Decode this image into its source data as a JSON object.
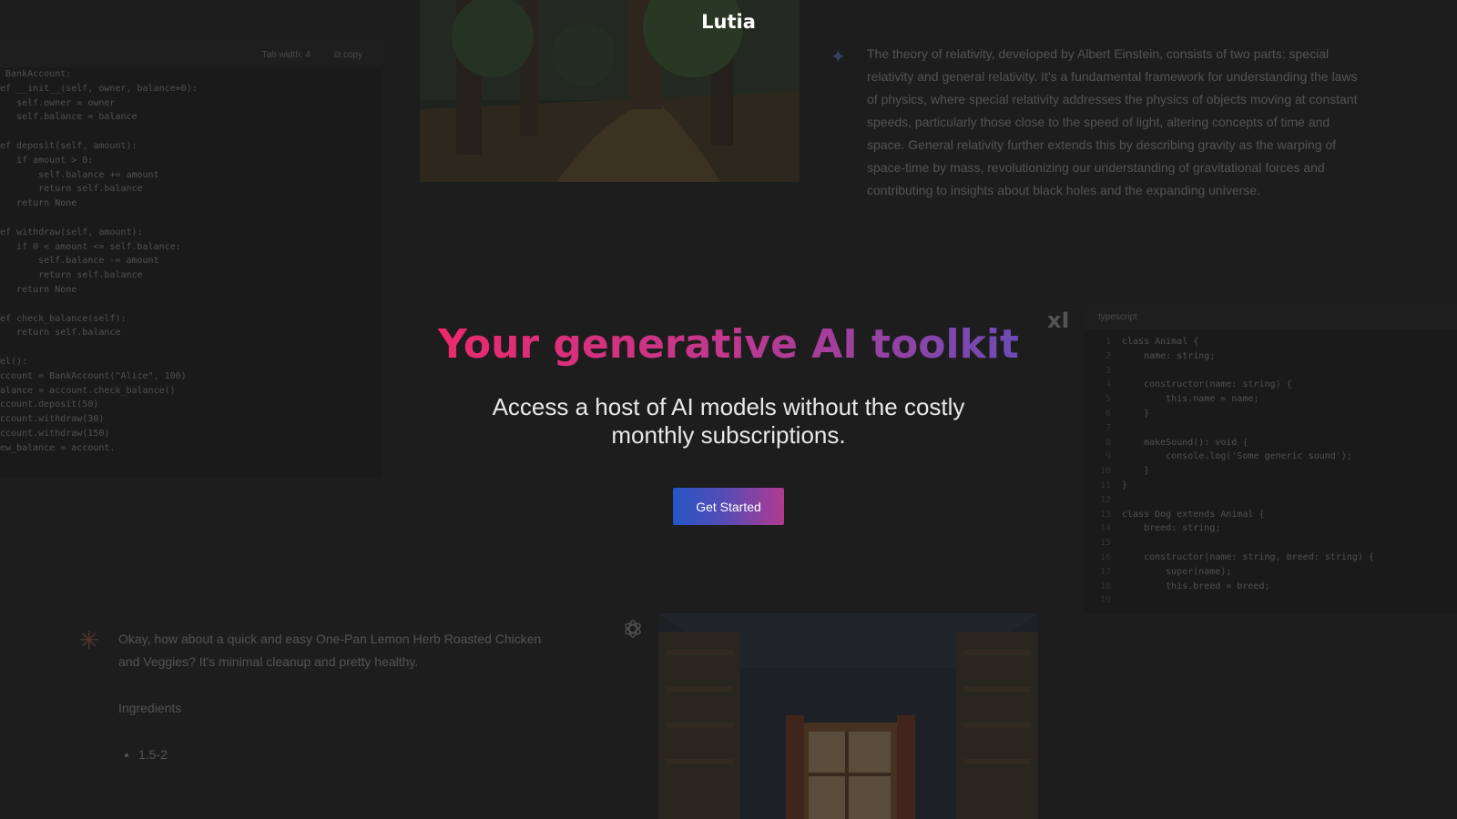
{
  "brand": {
    "name": "Lutia"
  },
  "hero": {
    "title": "Your generative AI toolkit",
    "subtitle": "Access a host of AI models without the costly monthly subscriptions.",
    "cta_label": "Get Started"
  },
  "background": {
    "left_code": {
      "toolbar": {
        "tab_width_label": "Tab width: 4",
        "copy_label": "copy"
      },
      "lines": [
        " BankAccount:",
        "ef __init__(self, owner, balance=0):",
        "   self.owner = owner",
        "   self.balance = balance",
        "",
        "ef deposit(self, amount):",
        "   if amount > 0:",
        "       self.balance += amount",
        "       return self.balance",
        "   return None",
        "",
        "ef withdraw(self, amount):",
        "   if 0 < amount <= self.balance:",
        "       self.balance -= amount",
        "       return self.balance",
        "   return None",
        "",
        "ef check_balance(self):",
        "   return self.balance",
        "",
        "el():",
        "ccount = BankAccount(\"Alice\", 100)",
        "alance = account.check_balance()",
        "ccount.deposit(50)",
        "ccount.withdraw(30)",
        "ccount.withdraw(150)",
        "ew_balance = account."
      ]
    },
    "gemini": {
      "icon": "sparkle-icon",
      "text": "The theory of relativity, developed by Albert Einstein, consists of two parts: special relativity and general relativity. It's a fundamental framework for understanding the laws of physics, where special relativity addresses the physics of objects moving at constant speeds, particularly those close to the speed of light, altering concepts of time and space. General relativity further extends this by describing gravity as the warping of space-time by mass, revolutionizing our understanding of gravitational forces and contributing to insights about black holes and the expanding universe."
    },
    "right_code": {
      "logo": "xI",
      "language_label": "typescript",
      "lines": [
        {
          "n": "1",
          "code": "class Animal {"
        },
        {
          "n": "2",
          "code": "    name: string;"
        },
        {
          "n": "3",
          "code": ""
        },
        {
          "n": "4",
          "code": "    constructor(name: string) {"
        },
        {
          "n": "5",
          "code": "        this.name = name;"
        },
        {
          "n": "6",
          "code": "    }"
        },
        {
          "n": "7",
          "code": ""
        },
        {
          "n": "8",
          "code": "    makeSound(): void {"
        },
        {
          "n": "9",
          "code": "        console.log('Some generic sound');"
        },
        {
          "n": "10",
          "code": "    }"
        },
        {
          "n": "11",
          "code": "}"
        },
        {
          "n": "12",
          "code": ""
        },
        {
          "n": "13",
          "code": "class Dog extends Animal {"
        },
        {
          "n": "14",
          "code": "    breed: string;"
        },
        {
          "n": "15",
          "code": ""
        },
        {
          "n": "16",
          "code": "    constructor(name: string, breed: string) {"
        },
        {
          "n": "17",
          "code": "        super(name);"
        },
        {
          "n": "18",
          "code": "        this.breed = breed;"
        },
        {
          "n": "19",
          "code": ""
        }
      ]
    },
    "claude": {
      "icon": "claude-burst-icon",
      "intro": "Okay, how about a quick and easy One-Pan Lemon Herb Roasted Chicken and Veggies? It's minimal cleanup and pretty healthy.",
      "ingredients_heading": "Ingredients",
      "ingredients": [
        "1.5-2"
      ]
    },
    "openai": {
      "icon": "openai-logo-icon"
    }
  },
  "colors": {
    "background": "#1d1d1d",
    "title_gradient": [
      "#ec2a6c",
      "#c0388e",
      "#6d4bb6"
    ],
    "cta_gradient": [
      "#2457c5",
      "#5b4bb4",
      "#b23a8f"
    ]
  }
}
